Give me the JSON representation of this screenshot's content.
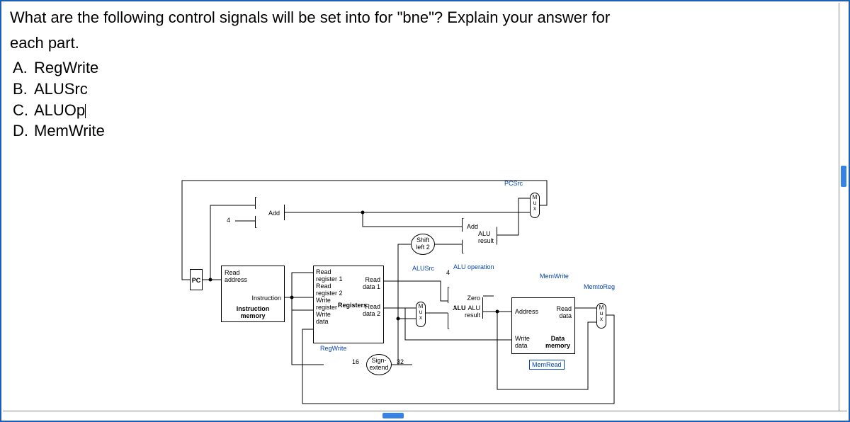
{
  "question": {
    "line1": "What are the following control signals will be set into for \"bne\"? Explain your answer for",
    "line2": "each part.",
    "parts": [
      {
        "letter": "A.",
        "text": "RegWrite"
      },
      {
        "letter": "B.",
        "text": "ALUSrc"
      },
      {
        "letter": "C.",
        "text": "ALUOp"
      },
      {
        "letter": "D.",
        "text": "MemWrite"
      }
    ]
  },
  "diagram": {
    "pc": "PC",
    "read_address": "Read\naddress",
    "instruction": "Instruction",
    "instruction_memory": "Instruction\nmemory",
    "four": "4",
    "add_top": "Add",
    "add_branch": "Add",
    "alu_result_branch": "ALU\nresult",
    "shift_left2": "Shift\nleft 2",
    "read_reg1": "Read\nregister 1",
    "read_reg2": "Read\nregister 2",
    "write_reg": "Write\nregister",
    "write_data": "Write\ndata",
    "registers": "Registers",
    "read_data1": "Read\ndata 1",
    "read_data2": "Read\ndata 2",
    "regwrite": "RegWrite",
    "sign_extend": "Sign-\nextend",
    "sixteen": "16",
    "thirtytwo": "32",
    "alusrc": "ALUSrc",
    "alu": "ALU",
    "zero": "Zero",
    "alu_result": "ALU\nresult",
    "alu_operation": "ALU operation",
    "address": "Address",
    "write_data_mem": "Write\ndata",
    "read_data_mem": "Read\ndata",
    "data_memory": "Data\nmemory",
    "memwrite": "MemWrite",
    "memread": "MemRead",
    "memtoreg": "MemtoReg",
    "pcsrc": "PCSrc",
    "mux": "M\nu\nx",
    "four_bus": "4"
  }
}
